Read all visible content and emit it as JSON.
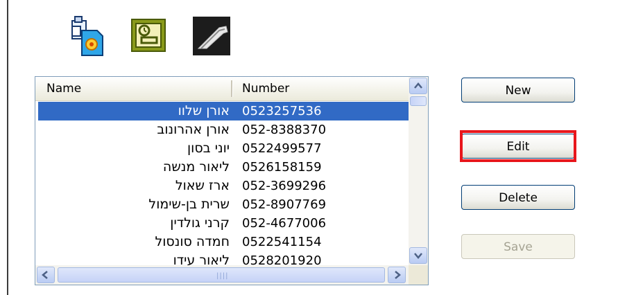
{
  "toolbar": {
    "icons": [
      {
        "name": "export-file-icon"
      },
      {
        "name": "contact-card-icon"
      },
      {
        "name": "tool-icon"
      }
    ]
  },
  "contacts_list": {
    "columns": [
      "Name",
      "Number"
    ],
    "rows": [
      {
        "name": "אורן שלוו",
        "number": "0523257536",
        "selected": true
      },
      {
        "name": "אורן אהרונוב",
        "number": "052-8388370"
      },
      {
        "name": "יוני בסון",
        "number": "0522499577"
      },
      {
        "name": "ליאור מנשה",
        "number": "0526158159"
      },
      {
        "name": "ארז שאול",
        "number": "052-3699296"
      },
      {
        "name": "שרית בן-שימול",
        "number": "052-8907769"
      },
      {
        "name": "קרני גולדין",
        "number": "052-4677006"
      },
      {
        "name": "חמדה סונסול",
        "number": "0522541154"
      },
      {
        "name": "ליאור עידו",
        "number": "0528201920"
      }
    ]
  },
  "buttons": {
    "new": "New",
    "edit": "Edit",
    "delete": "Delete",
    "save": "Save"
  },
  "colors": {
    "selection": "#316ac5",
    "highlight": "#e8161c"
  }
}
